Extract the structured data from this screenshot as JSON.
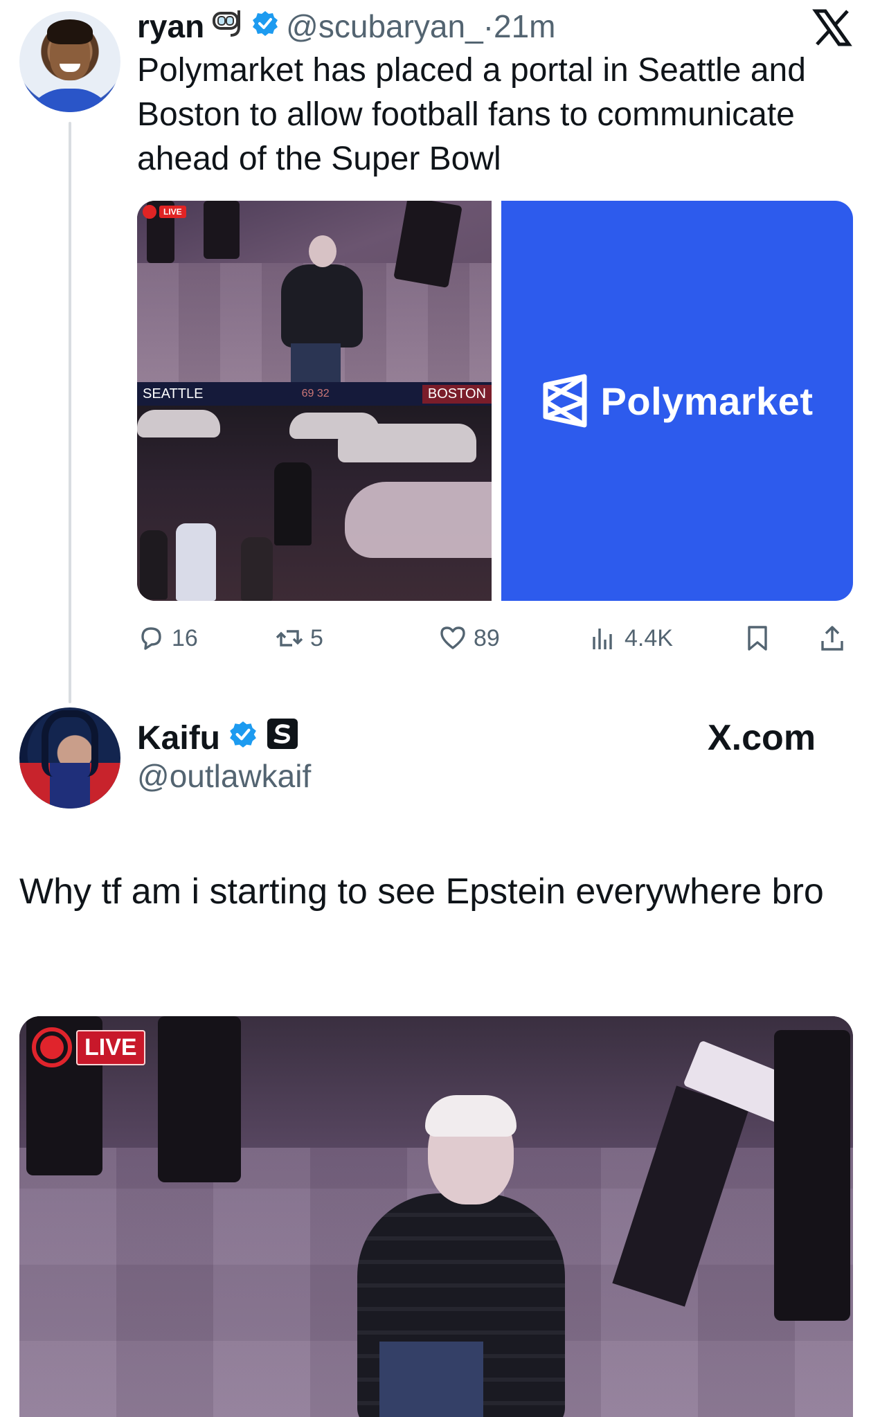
{
  "tweet1": {
    "display_name": "ryan",
    "handle": "@scubaryan_",
    "separator": "·",
    "time": "21m",
    "text": "Polymarket has placed a portal in Seattle and Boston to allow football fans to communicate ahead of the Super Bowl",
    "media": {
      "live_label": "LIVE",
      "left_city": "SEATTLE",
      "right_city": "BOSTON",
      "score": "69   32",
      "brand_name": "Polymarket",
      "brand_color": "#2d5bed"
    },
    "stats": {
      "replies": "16",
      "reposts": "5",
      "likes": "89",
      "views": "4.4K"
    },
    "icons": [
      "diving-mask-emoji-icon",
      "verified-badge-icon",
      "x-logo-icon"
    ]
  },
  "tweet2": {
    "display_name": "Kaifu",
    "handle": "@outlawkaif",
    "source": "X.com",
    "text": "Why tf am i starting to see Epstein everywhere bro",
    "media": {
      "live_label": "LIVE"
    },
    "icons": [
      "verified-badge-icon",
      "stake-badge-icon"
    ]
  },
  "colors": {
    "verified": "#1d9bf0",
    "secondary_text": "#536471",
    "live_red": "#e0242c"
  }
}
